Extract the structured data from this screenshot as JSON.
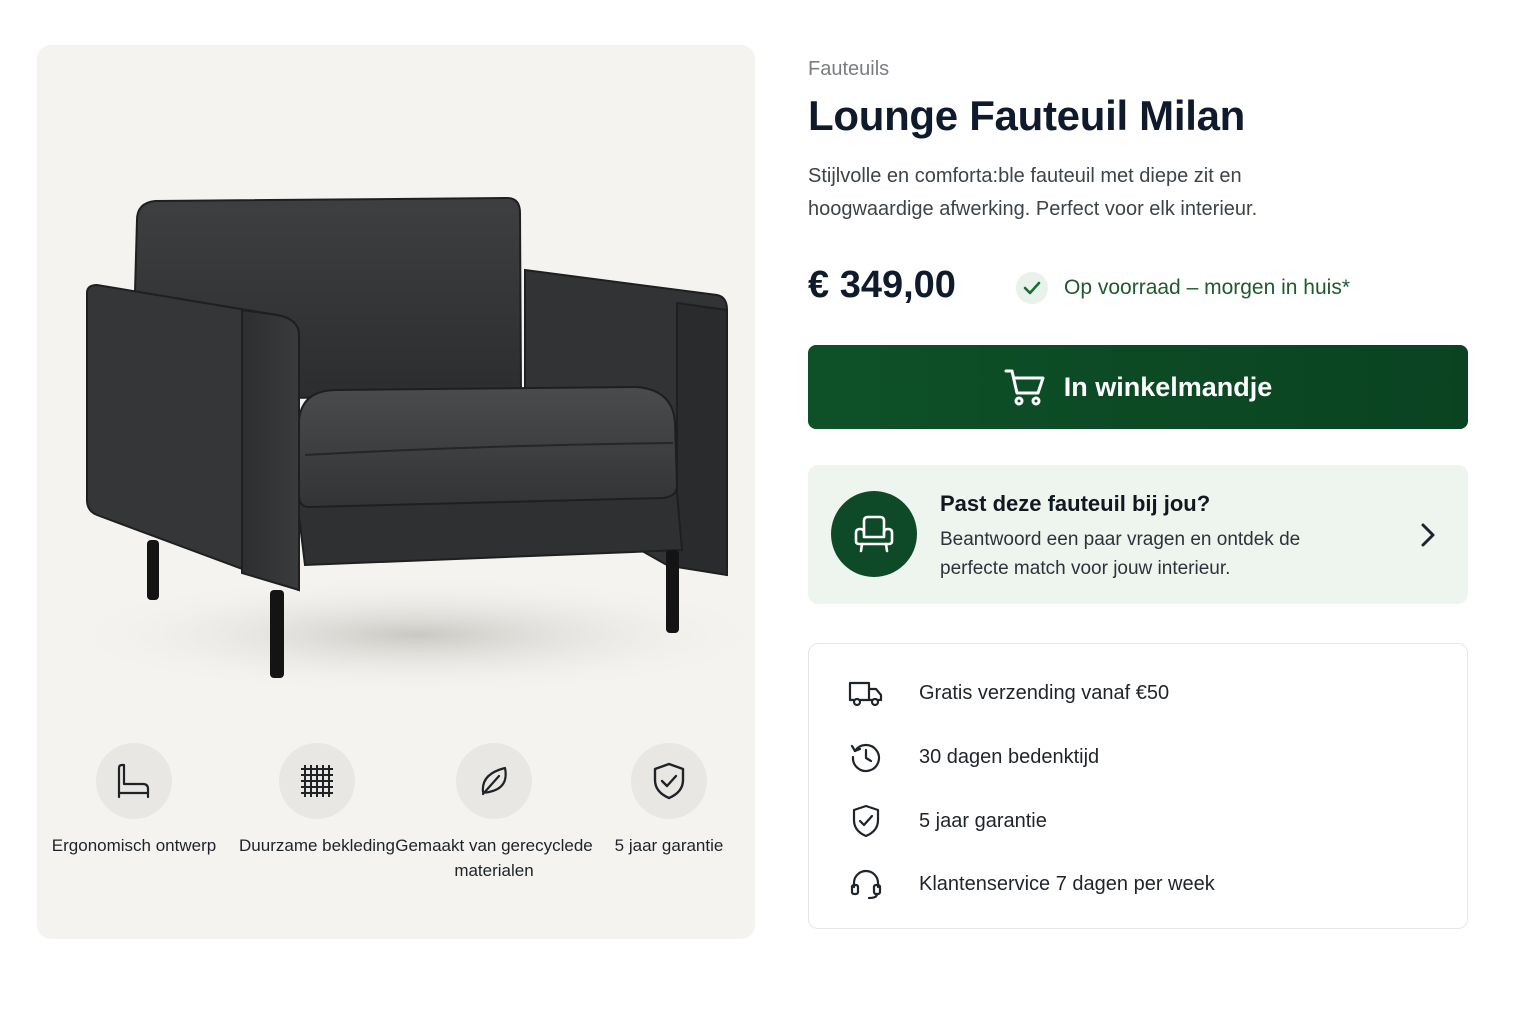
{
  "product": {
    "category": "Fauteuils",
    "title": "Lounge Fauteuil Milan",
    "description": "Stijlvolle en comforta:ble fauteuil met diepe zit en hoogwaardige afwerking. Perfect voor elk interieur.",
    "price": "€ 349,00",
    "stock_status": "Op voorraad – morgen in huis*"
  },
  "actions": {
    "add_to_cart_label": "In winkelmandje"
  },
  "quiz": {
    "title": "Past deze fauteuil bij jou?",
    "text": "Beantwoord een paar vragen en ontdek de perfecte match voor jouw interieur."
  },
  "features": [
    {
      "label": "Ergonomisch ontwerp",
      "icon": "chair-outline-icon"
    },
    {
      "label": "Duurzame bekleding",
      "icon": "fabric-weave-icon"
    },
    {
      "label": "Gemaakt van gerecyclede materialen",
      "icon": "leaf-icon"
    },
    {
      "label": "5 jaar garantie",
      "icon": "shield-check-icon"
    }
  ],
  "benefits": [
    {
      "text": "Gratis verzending vanaf €50",
      "icon": "truck-icon"
    },
    {
      "text": "30 dagen bedenktijd",
      "icon": "history-icon"
    },
    {
      "text": "5 jaar garantie",
      "icon": "shield-check-icon"
    },
    {
      "text": "Klantenservice 7 dagen per week",
      "icon": "headset-icon"
    }
  ],
  "colors": {
    "brand_green": "#0e5128",
    "stock_green": "#1d5a2c",
    "quiz_background": "#eef4ee",
    "image_background": "#f4f3f0"
  }
}
